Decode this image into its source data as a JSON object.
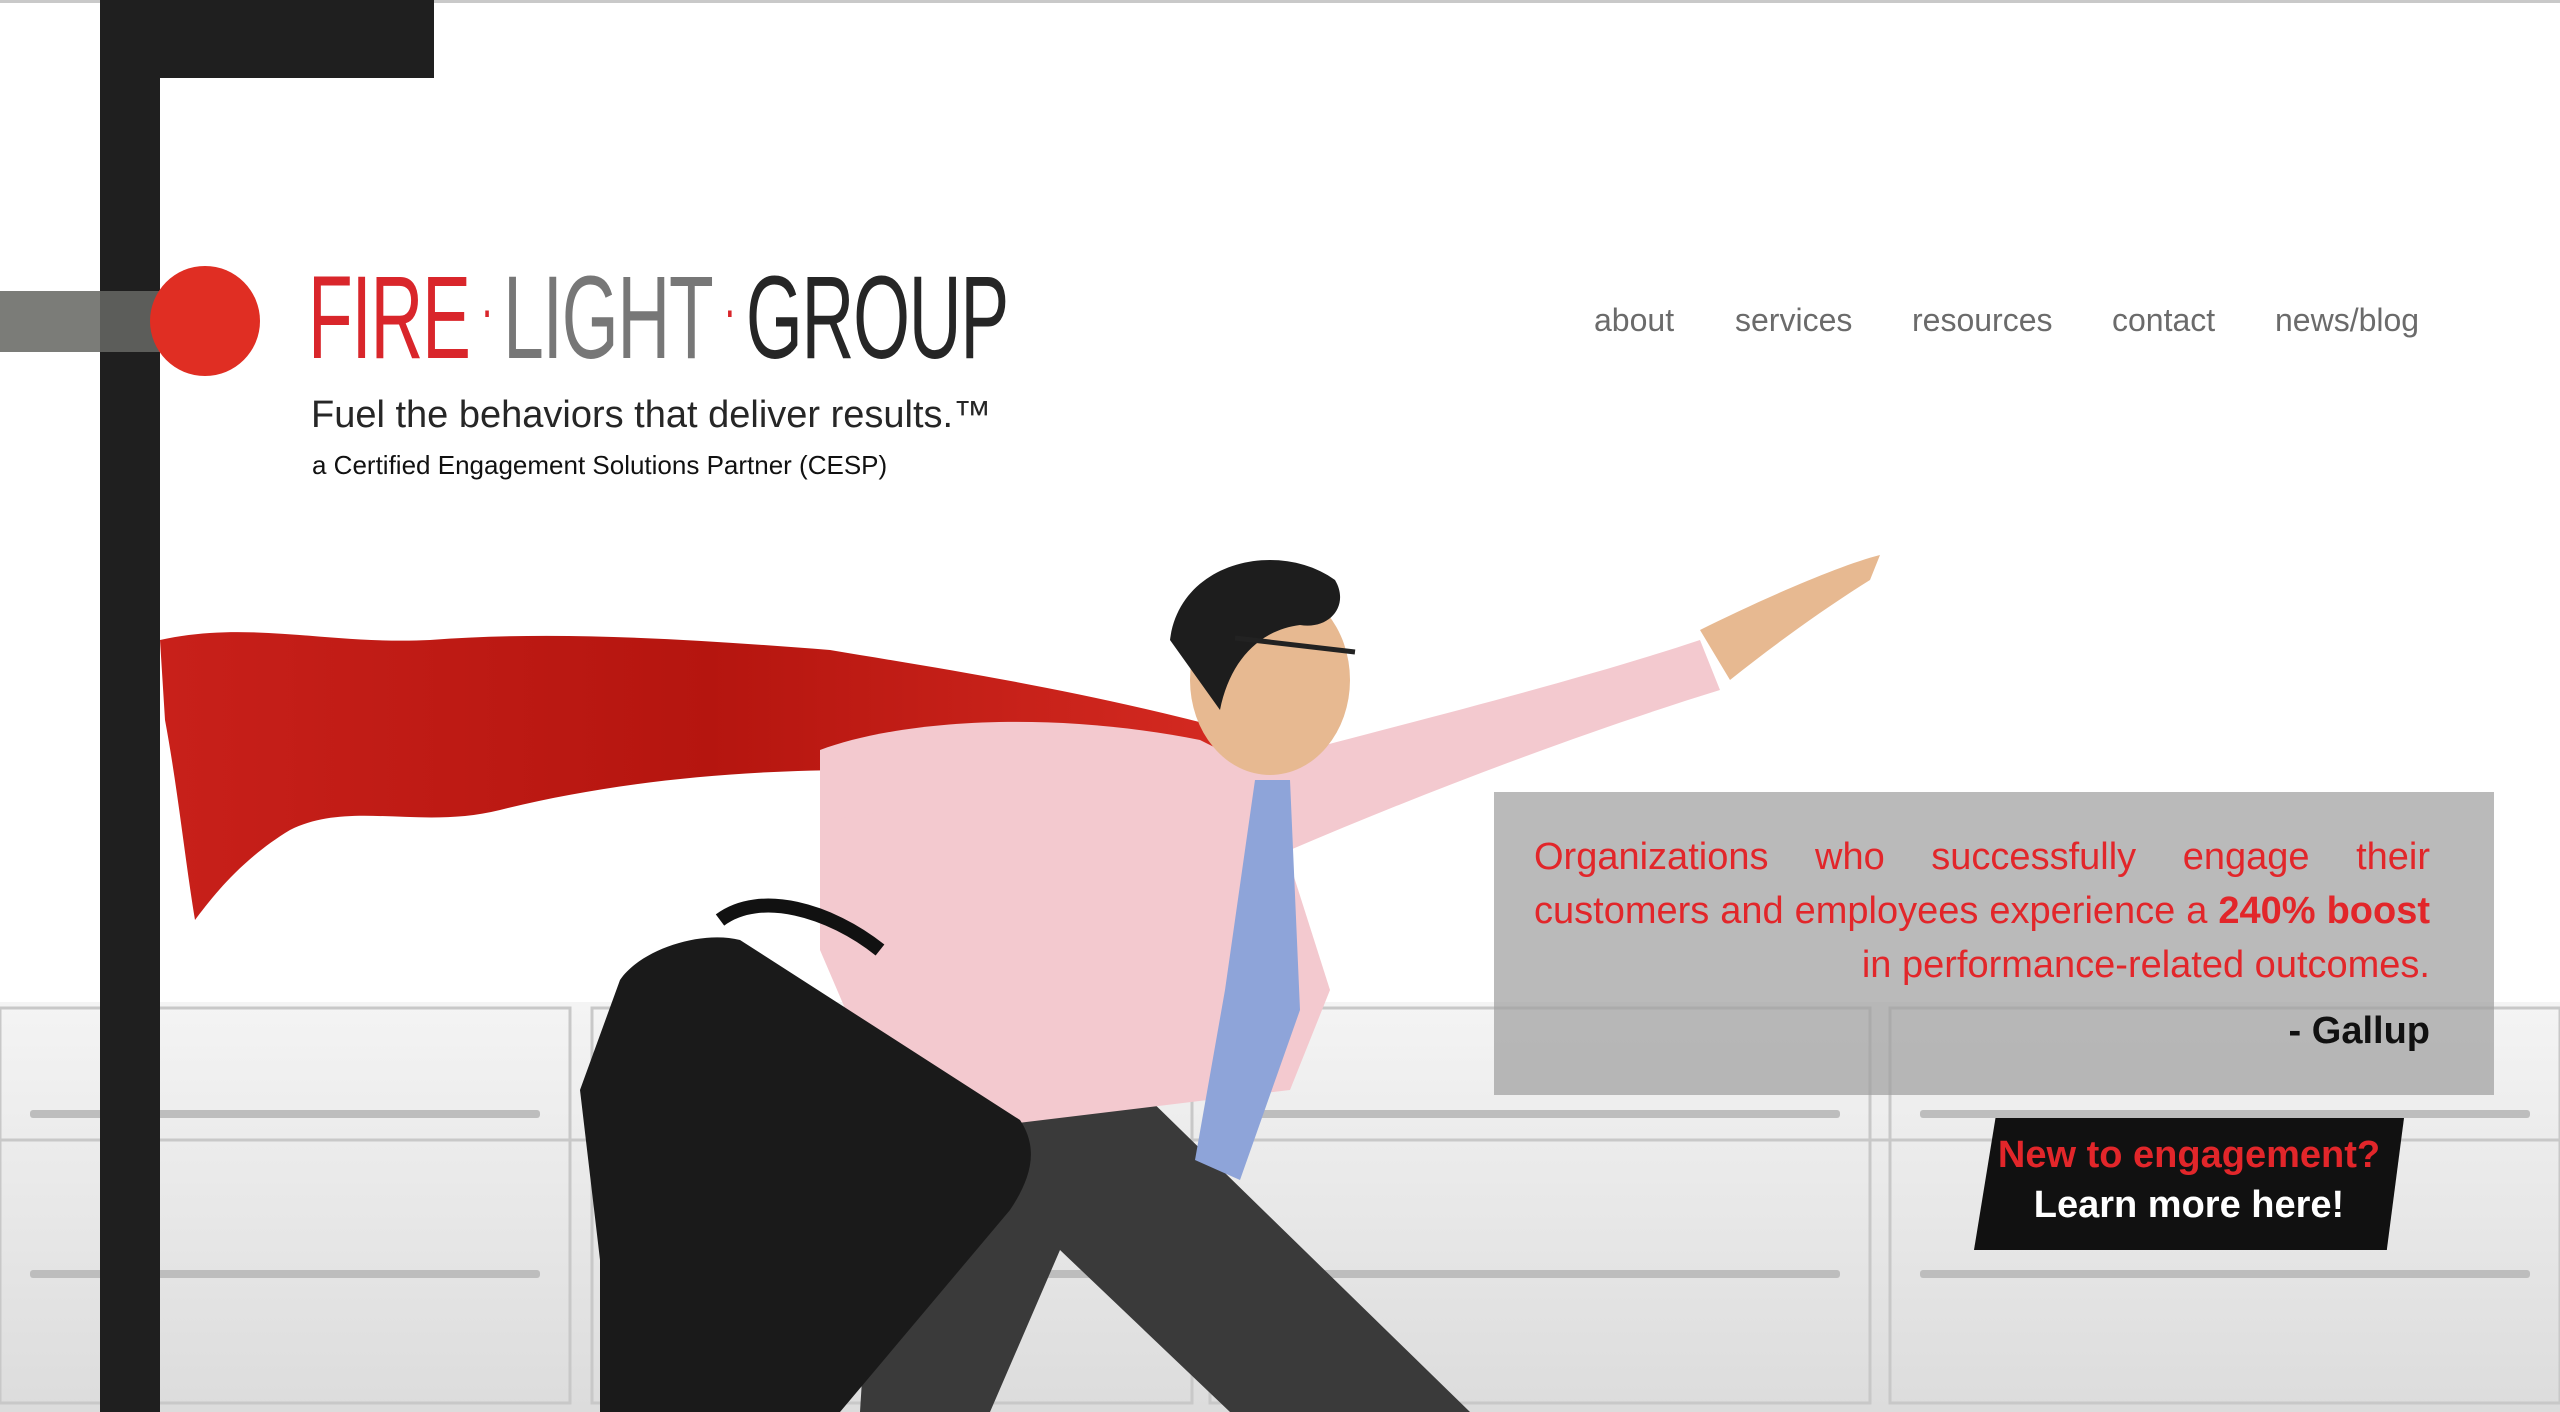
{
  "brand": {
    "logo_fire": "FIRE",
    "logo_light": "LIGHT",
    "logo_group": "GROUP",
    "logo_separator": "·",
    "tagline": "Fuel the behaviors that deliver results.™",
    "certification": "a Certified Engagement Solutions Partner (CESP)",
    "accent_color": "#e02e23"
  },
  "nav": {
    "items": [
      {
        "label": "about"
      },
      {
        "label": "services"
      },
      {
        "label": "resources"
      },
      {
        "label": "contact"
      },
      {
        "label": "news/blog"
      }
    ]
  },
  "hero": {
    "image": "businessman-with-red-cape-running-icon",
    "quote": {
      "text_part1": "Organizations who successfully engage their customers and employees experience a ",
      "text_bold": "240% boost",
      "text_part2": " in performance-related outcomes.",
      "source": "- Gallup"
    },
    "cta": {
      "line1": "New to engagement?",
      "line2": "Learn more here!"
    }
  }
}
